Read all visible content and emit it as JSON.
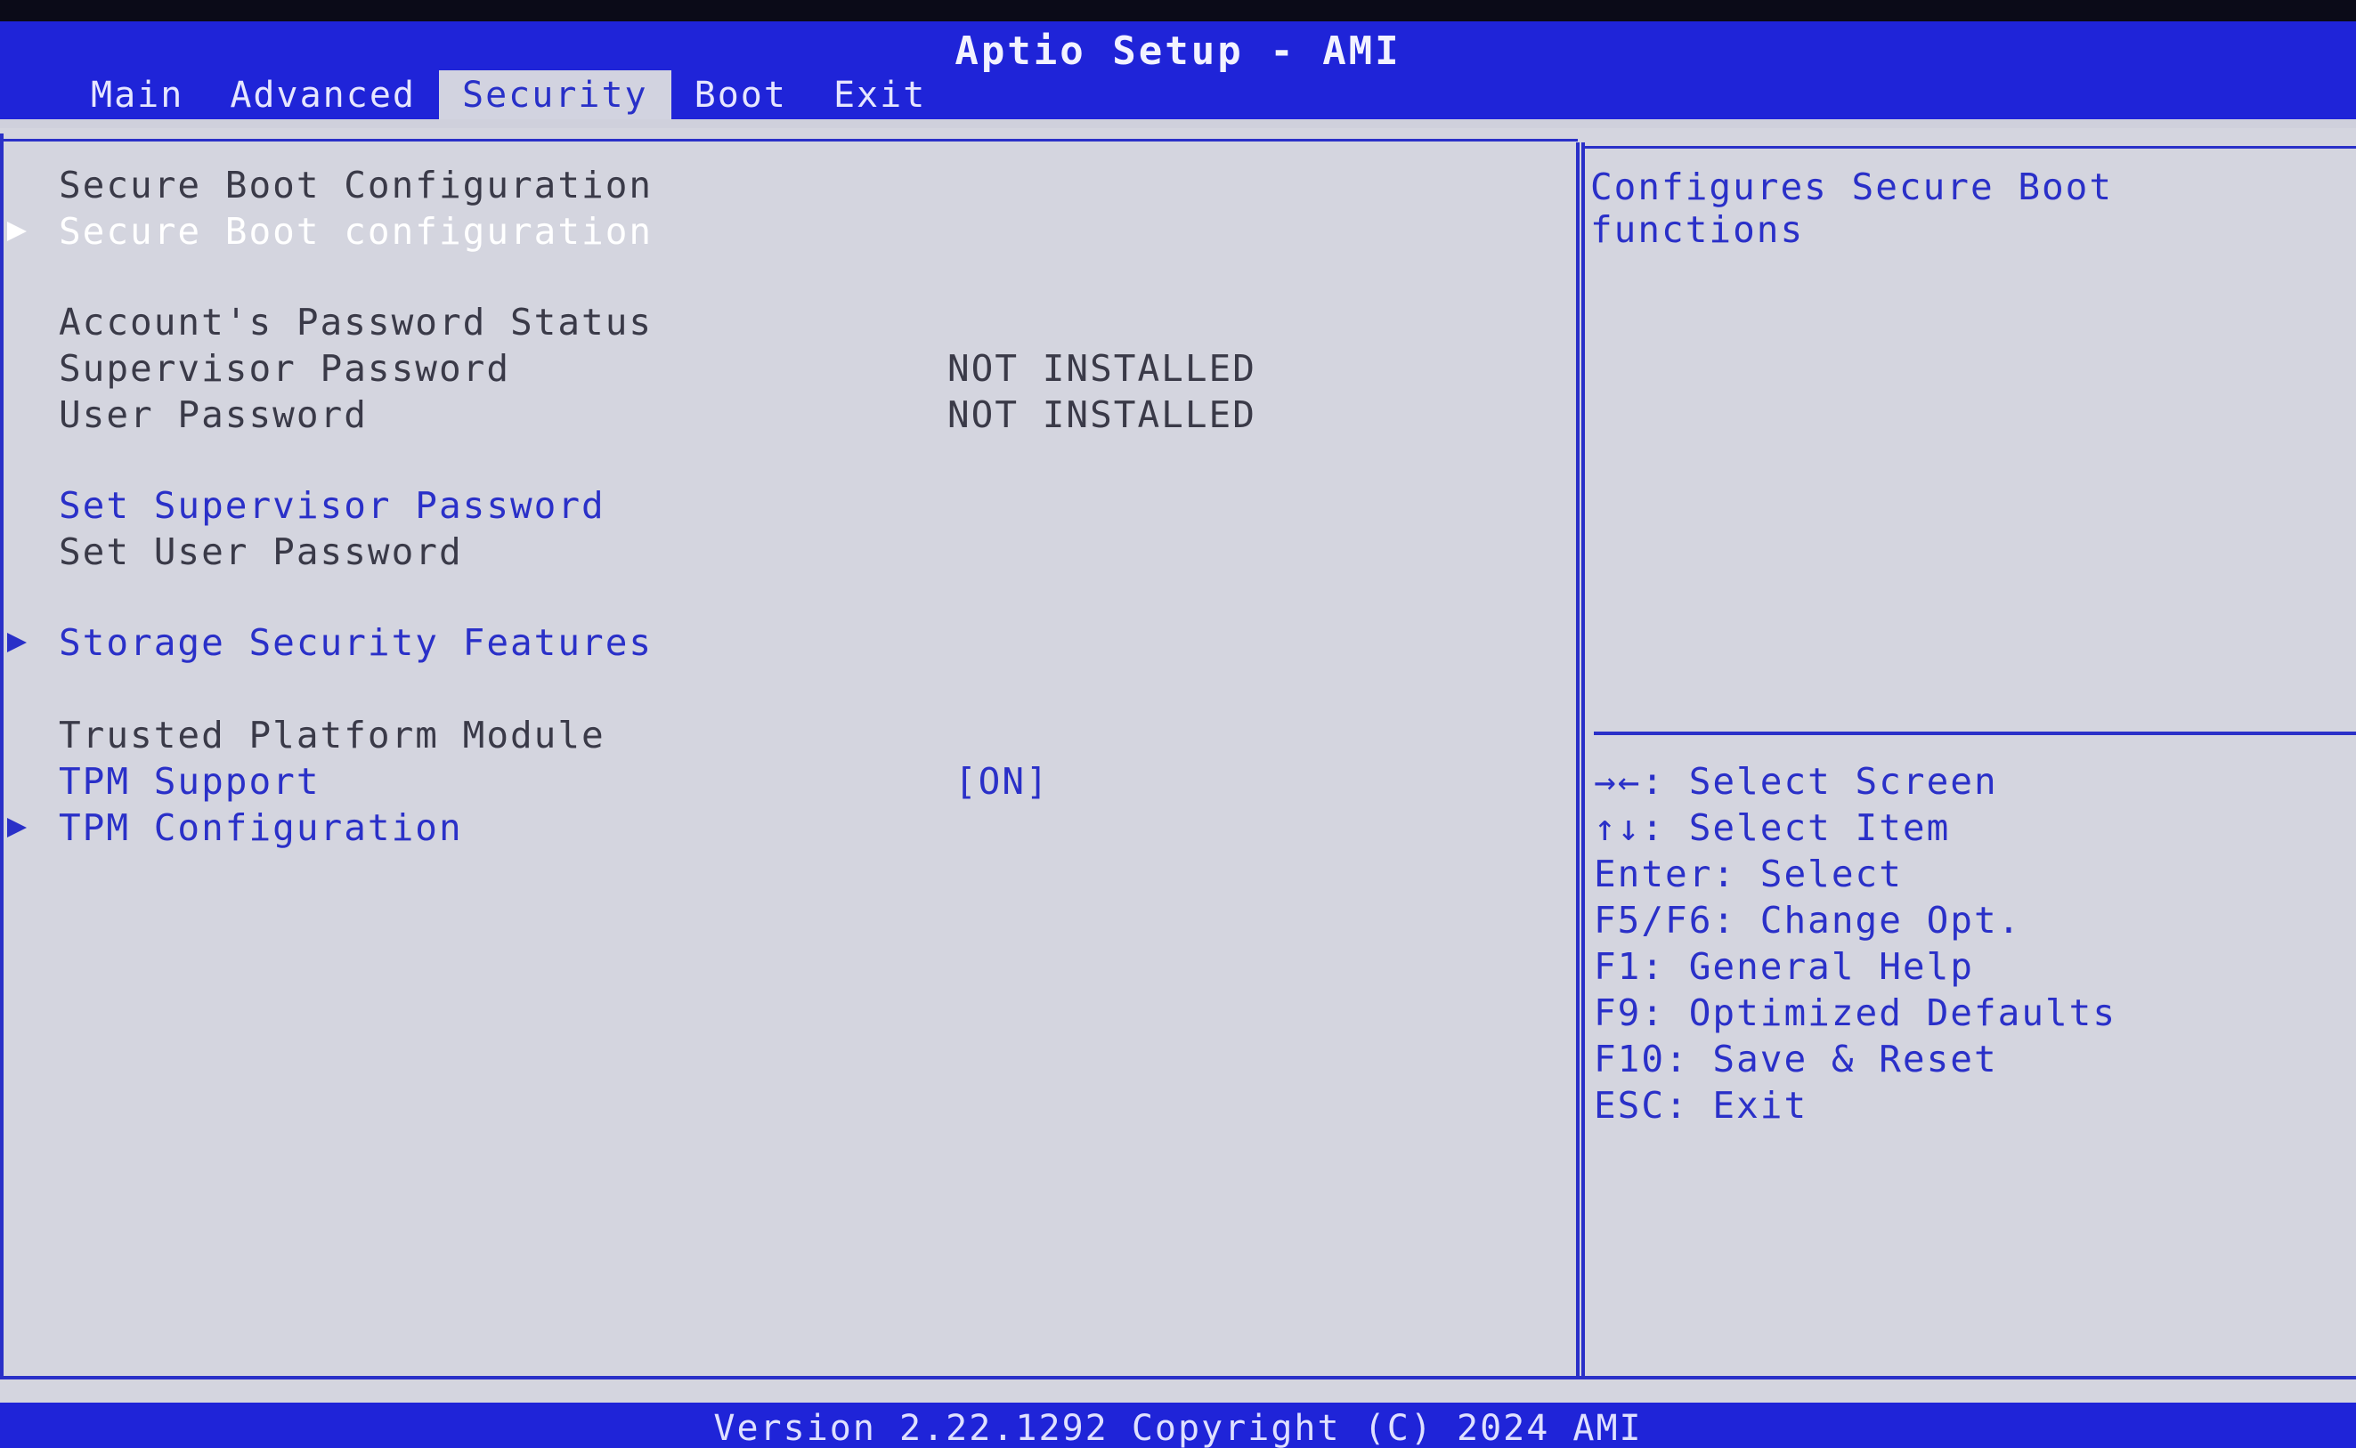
{
  "app": {
    "title": "Aptio Setup - AMI"
  },
  "tabs": [
    {
      "label": "Main",
      "active": false
    },
    {
      "label": "Advanced",
      "active": false
    },
    {
      "label": "Security",
      "active": true
    },
    {
      "label": "Boot",
      "active": false
    },
    {
      "label": "Exit",
      "active": false
    }
  ],
  "menu": {
    "secure_boot_header": "Secure Boot Configuration",
    "secure_boot_item": "Secure Boot configuration",
    "password_status_header": "Account's Password Status",
    "supervisor_password_label": "Supervisor Password",
    "supervisor_password_value": "NOT INSTALLED",
    "user_password_label": "User Password",
    "user_password_value": "NOT INSTALLED",
    "set_supervisor_password": "Set Supervisor Password",
    "set_user_password": "Set User Password",
    "storage_security_features": "Storage Security Features",
    "tpm_header": "Trusted Platform Module",
    "tpm_support_label": "TPM Support",
    "tpm_support_value": "[ON]",
    "tpm_configuration": "TPM Configuration"
  },
  "help": {
    "description": "Configures Secure Boot functions",
    "keys": [
      "→←: Select Screen",
      "↑↓: Select Item",
      "Enter: Select",
      "F5/F6: Change Opt.",
      "F1: General Help",
      "F9: Optimized Defaults",
      "F10: Save & Reset",
      "ESC: Exit"
    ]
  },
  "footer": {
    "version": "Version 2.22.1292 Copyright (C) 2024 AMI"
  },
  "colors": {
    "header_blue": "#1f24d8",
    "panel_gray": "#d4d5df",
    "accent_blue": "#2a30c8",
    "text_gray": "#3a3a48",
    "highlight_white": "#ffffff"
  }
}
